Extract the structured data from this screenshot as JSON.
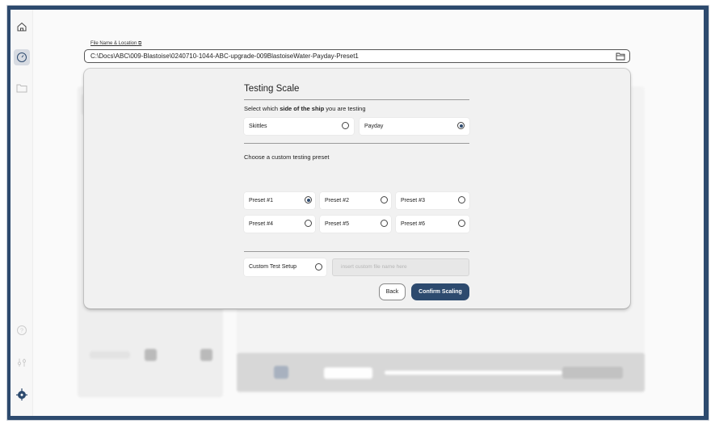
{
  "file": {
    "label": "File Name & Location",
    "path": "C:\\Docs\\ABC\\009-Blastoise\\0240710-1044-ABC-upgrade-009BlastoiseWater-Payday-Preset1"
  },
  "sidebar": {
    "icons": [
      "home-icon",
      "gauge-icon",
      "folder-icon",
      "help-icon",
      "sliders-icon",
      "ship-wheel-icon"
    ]
  },
  "modal": {
    "title": "Testing Scale",
    "side_prompt": {
      "pre": "Select which ",
      "bold": "side of the ship",
      "post": " you are testing"
    },
    "sides": [
      {
        "label": "Skittles",
        "selected": false
      },
      {
        "label": "Payday",
        "selected": true
      }
    ],
    "preset_prompt": "Choose a custom testing preset",
    "presets": [
      {
        "label": "Preset #1",
        "selected": true
      },
      {
        "label": "Preset #2",
        "selected": false
      },
      {
        "label": "Preset #3",
        "selected": false
      },
      {
        "label": "Preset #4",
        "selected": false
      },
      {
        "label": "Preset #5",
        "selected": false
      },
      {
        "label": "Preset #6",
        "selected": false
      }
    ],
    "custom": {
      "label": "Custom Test Setup",
      "selected": false,
      "placeholder": "insert custom file name here"
    },
    "back_label": "Back",
    "confirm_label": "Confirm Scaling"
  },
  "colors": {
    "accent": "#2d4a6e",
    "frame": "#2d4a6e"
  }
}
